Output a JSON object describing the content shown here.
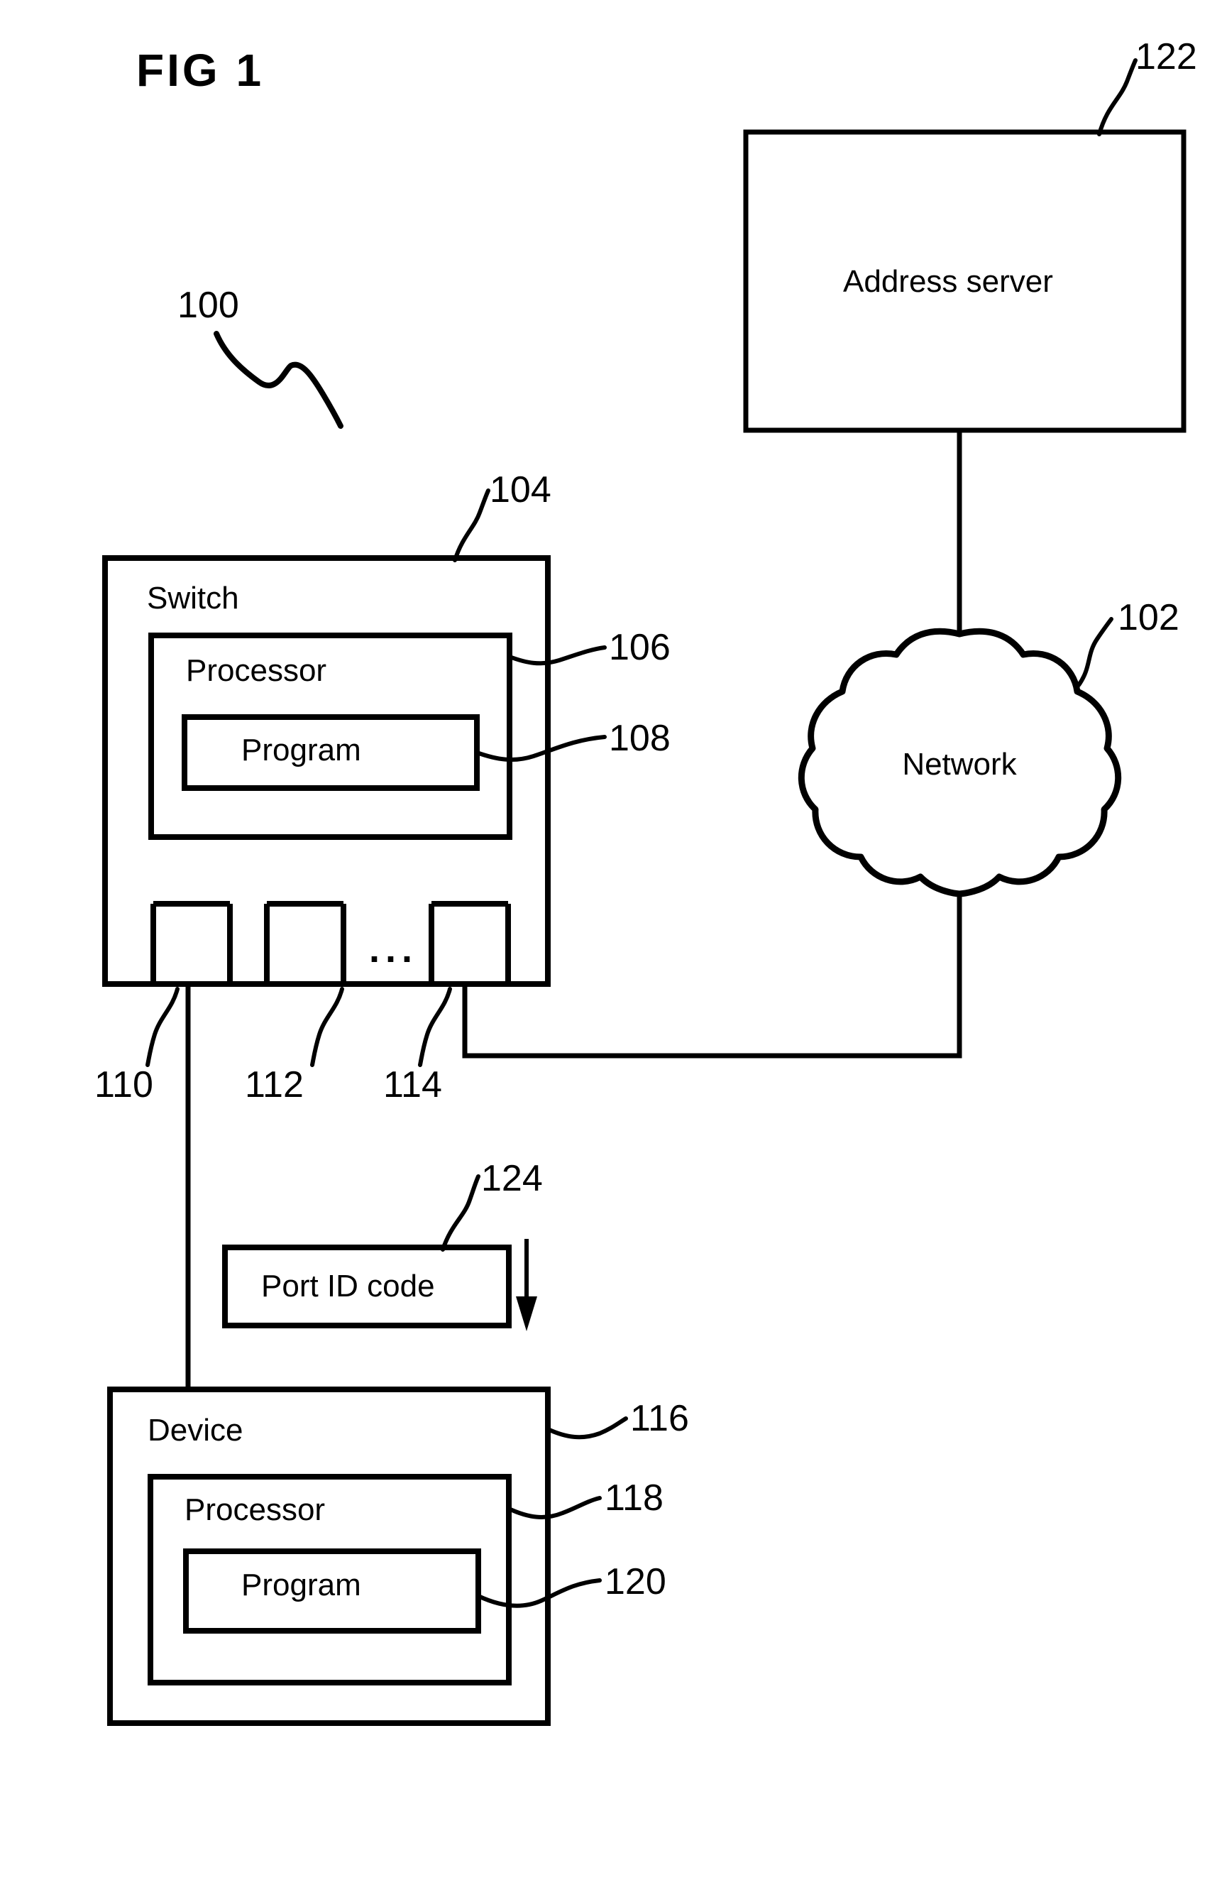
{
  "figure": {
    "title": "FIG  1",
    "system_ref": "100"
  },
  "nodes": {
    "address_server": {
      "label": "Address server",
      "ref": "122"
    },
    "network": {
      "label": "Network",
      "ref": "102"
    },
    "switch": {
      "label": "Switch",
      "ref": "104",
      "processor": {
        "label": "Processor",
        "ref": "106",
        "program": {
          "label": "Program",
          "ref": "108"
        }
      },
      "ports": [
        {
          "ref": "110"
        },
        {
          "ref": "112"
        },
        {
          "ref": "114"
        }
      ],
      "ports_ellipsis": "..."
    },
    "port_id_code": {
      "label": "Port  ID code",
      "ref": "124"
    },
    "device": {
      "label": "Device",
      "ref": "116",
      "processor": {
        "label": "Processor",
        "ref": "118",
        "program": {
          "label": "Program",
          "ref": "120"
        }
      }
    }
  },
  "colors": {
    "ink": "#000000",
    "paper": "#ffffff"
  }
}
